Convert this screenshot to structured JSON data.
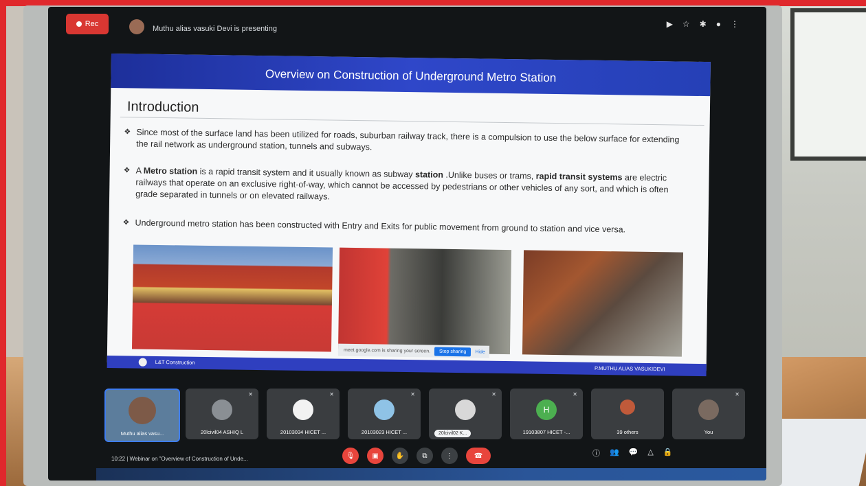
{
  "meet": {
    "rec_label": "Rec",
    "presenter_text": "Muthu alias vasuki Devi is presenting",
    "time": "10:22",
    "meeting_title": "Webinar on \"Overview of Construction of Unde..."
  },
  "slide": {
    "title": "Overview on Construction of  Underground Metro Station",
    "heading": "Introduction",
    "bullet1": "Since most of the surface land has been utilized for roads, suburban railway track, there is a compulsion to use the below surface for extending the rail network as underground station, tunnels and subways.",
    "bullet2_prefix": "A ",
    "bullet2_strong1": "Metro station",
    "bullet2_mid1": " is a rapid transit system and it usually known as subway ",
    "bullet2_strong2": "station",
    "bullet2_mid2": " .Unlike buses or trams, ",
    "bullet2_strong3": "rapid transit systems",
    "bullet2_rest": " are electric railways that operate on an exclusive right-of-way, which cannot be accessed by pedestrians or other vehicles of any sort, and which is often grade separated in tunnels or on elevated railways.",
    "bullet3": "Underground metro station has been constructed with Entry and Exits for public movement from ground to station and vice versa.",
    "footer_left": "L&T Construction",
    "footer_right": "P.MUTHU ALIAS VASUKIDEVI"
  },
  "share_bar": {
    "message": "meet.google.com is sharing your screen.",
    "stop_label": "Stop sharing",
    "hide_label": "Hide"
  },
  "participants": [
    {
      "name": "Muthu alias vasu..."
    },
    {
      "name": "20lcivil04 ASHIQ L"
    },
    {
      "name": "20103034 HICET ..."
    },
    {
      "name": "20103023 HICET ..."
    },
    {
      "name": "20lcivil02 K..."
    },
    {
      "name": "19103807 HICET -..."
    },
    {
      "name": "39 others"
    },
    {
      "name": "You"
    }
  ],
  "participant_initial": "H"
}
